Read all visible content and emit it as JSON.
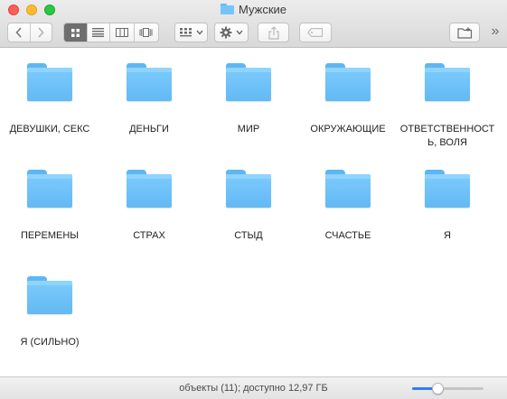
{
  "window": {
    "title": "Мужские"
  },
  "toolbar": {
    "back_icon": "chevron-left-icon",
    "forward_icon": "chevron-right-icon",
    "view_modes": [
      "icon-view-icon",
      "list-view-icon",
      "column-view-icon",
      "coverflow-view-icon"
    ],
    "active_view": "icon-view-icon",
    "arrange_icon": "arrange-grid-icon",
    "action_icon": "gear-icon",
    "share_icon": "share-icon",
    "tag_icon": "tag-icon",
    "new_folder_icon": "new-folder-icon",
    "overflow_label": "»"
  },
  "items": [
    {
      "label": "ДЕВУШКИ, СЕКС"
    },
    {
      "label": "ДЕНЬГИ"
    },
    {
      "label": "МИР"
    },
    {
      "label": "ОКРУЖАЮЩИЕ"
    },
    {
      "label": "ОТВЕТСТВЕННОСТЬ, ВОЛЯ"
    },
    {
      "label": "ПЕРЕМЕНЫ"
    },
    {
      "label": "СТРАХ"
    },
    {
      "label": "СТЫД"
    },
    {
      "label": "СЧАСТЬЕ"
    },
    {
      "label": "Я"
    },
    {
      "label": "Я (СИЛЬНО)"
    }
  ],
  "statusbar": {
    "text": "объекты (11); доступно 12,97 ГБ",
    "icon_size_level": 0.35
  },
  "colors": {
    "folder": "#74c5fb",
    "accent": "#2f7df6"
  }
}
